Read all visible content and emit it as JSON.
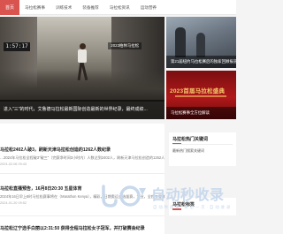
{
  "nav": {
    "home": "首页",
    "items": [
      "马拉松赛事",
      "训练技术",
      "装备推荐",
      "马拉松资讯",
      "运动营养"
    ]
  },
  "hero": {
    "time_display": "1:57:17",
    "badge": "2023柏林马拉松",
    "caption": "进入\"三\"的时代，艾鲁德马拉松最新国际创造最新的世界纪录，最终成绩..."
  },
  "side_cards": [
    {
      "caption": "第21届纽约马拉松赛后的独家回顾报道"
    },
    {
      "banner": "2023首届马拉松盛典",
      "caption": "马拉松赛事全方位解读"
    }
  ],
  "news": [
    {
      "title": "马拉松2402人破3，刷新天津马拉松创造的1262人数纪录",
      "summary": "…2024年马拉松全程破3\"破三\"（完赛净时间3小时内）人数达到2402人，刷新天津马拉松创造的1262人数纪录…",
      "date": "2024-02-06 09:43"
    },
    {
      "title": "马拉松直播预告，16月8日20:30 五星体育",
      "summary": "2024年16日早上8时马拉松赛事将在（Marathon Kenya），精彩，日期奥运会选拔赛，专业，全程五星体育直播…",
      "date": "2024-01-20 09:52"
    },
    {
      "title": "马拉松辽宁选手白丽以2:31:50 获得全程马拉松女子冠军，并打破赛会纪录",
      "summary": "",
      "date": ""
    }
  ],
  "panels": [
    {
      "title": "马拉松热门关键词",
      "sub": "最新热门搜索关键词"
    },
    {
      "title": "马拉松标签",
      "sub": ""
    }
  ],
  "watermark": {
    "title": "自动秒收录",
    "subtitle": "自 动 秒 收 录 · 来 访 一 次 · 自 动 收 录"
  },
  "colors": {
    "accent": "#d9534f",
    "watermark": "#c9d9ec"
  }
}
